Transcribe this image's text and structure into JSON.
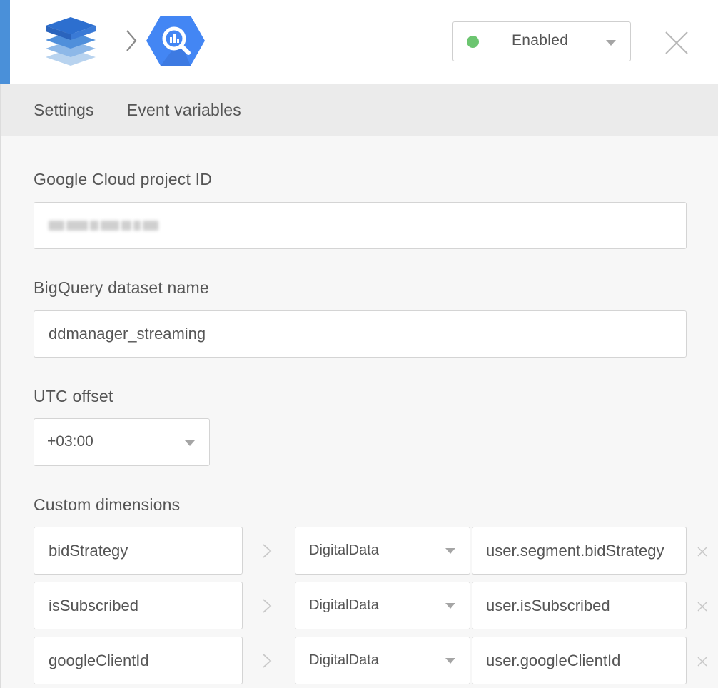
{
  "header": {
    "status": {
      "selected": "Enabled",
      "color": "#6cc570"
    }
  },
  "tabs": [
    {
      "label": "Settings"
    },
    {
      "label": "Event variables"
    }
  ],
  "form": {
    "project_id": {
      "label": "Google Cloud project ID",
      "value": ""
    },
    "dataset": {
      "label": "BigQuery dataset name",
      "value": "ddmanager_streaming"
    },
    "utc": {
      "label": "UTC offset",
      "value": "+03:00"
    },
    "custom_dimensions": {
      "label": "Custom dimensions",
      "rows": [
        {
          "name": "bidStrategy",
          "source": "DigitalData",
          "value": "user.segment.bidStrategy"
        },
        {
          "name": "isSubscribed",
          "source": "DigitalData",
          "value": "user.isSubscribed"
        },
        {
          "name": "googleClientId",
          "source": "DigitalData",
          "value": "user.googleClientId"
        }
      ]
    }
  },
  "colors": {
    "accent": "#4a90d9",
    "bigquery_blue": "#4386f4"
  },
  "icons": [
    "layers-icon",
    "chevron-right-icon",
    "bigquery-icon",
    "close-icon"
  ]
}
